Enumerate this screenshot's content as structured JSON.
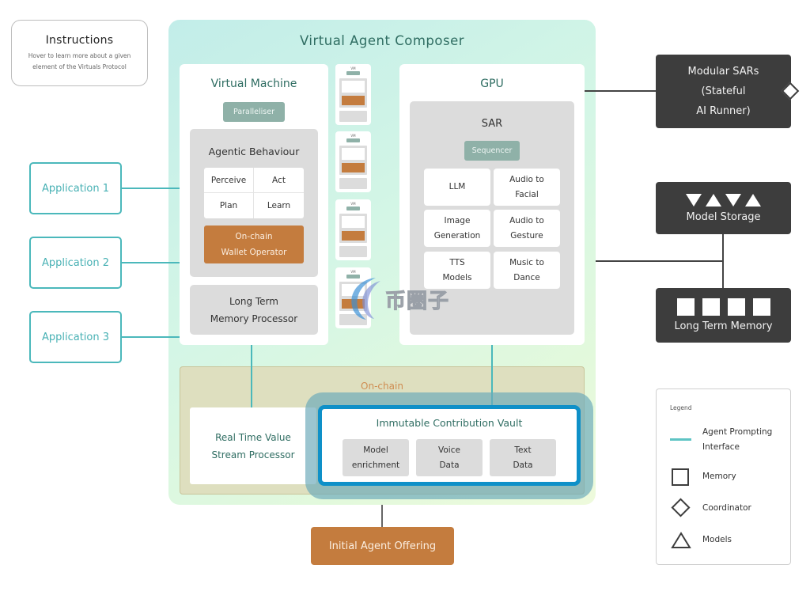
{
  "instructions": {
    "title": "Instructions",
    "description_line1": "Hover to learn more about a given",
    "description_line2": "element of the Virtuals Protocol"
  },
  "applications": [
    {
      "label": "Application 1"
    },
    {
      "label": "Application 2"
    },
    {
      "label": "Application 3"
    }
  ],
  "composer": {
    "title": "Virtual Agent Composer",
    "virtual_machine": {
      "title": "Virtual Machine",
      "paralleliser": "Paralleliser",
      "agentic_behaviour": {
        "title": "Agentic Behaviour",
        "cells": [
          "Perceive",
          "Act",
          "Plan",
          "Learn"
        ],
        "wallet_line1": "On-chain",
        "wallet_line2": "Wallet Operator"
      },
      "long_term_memory_processor_line1": "Long Term",
      "long_term_memory_processor_line2": "Memory Processor"
    },
    "vm_instances": [
      {
        "label": "VM"
      },
      {
        "label": "VM"
      },
      {
        "label": "VM"
      },
      {
        "label": "VM"
      }
    ],
    "gpu": {
      "title": "GPU",
      "sar": {
        "title": "SAR",
        "sequencer": "Sequencer",
        "cells": [
          {
            "line1": "LLM",
            "line2": ""
          },
          {
            "line1": "Audio to",
            "line2": "Facial"
          },
          {
            "line1": "Image",
            "line2": "Generation"
          },
          {
            "line1": "Audio to",
            "line2": "Gesture"
          },
          {
            "line1": "TTS",
            "line2": "Models"
          },
          {
            "line1": "Music to",
            "line2": "Dance"
          }
        ]
      }
    },
    "onchain": {
      "title": "On-chain",
      "rtv_line1": "Real Time Value",
      "rtv_line2": "Stream Processor",
      "vault": {
        "title": "Immutable Contribution Vault",
        "cells": [
          {
            "line1": "Model",
            "line2": "enrichment"
          },
          {
            "line1": "Voice",
            "line2": "Data"
          },
          {
            "line1": "Text",
            "line2": "Data"
          }
        ]
      }
    }
  },
  "right_nodes": {
    "modular_sars_line1": "Modular SARs",
    "modular_sars_line2": "(Stateful",
    "modular_sars_line3": "AI Runner)",
    "model_storage": "Model Storage",
    "long_term_memory": "Long Term Memory"
  },
  "initial_agent_offering": "Initial Agent Offering",
  "legend": {
    "title": "Legend",
    "items": [
      {
        "icon": "teal-line-icon",
        "line1": "Agent Prompting",
        "line2": "Interface"
      },
      {
        "icon": "square-icon",
        "line1": "Memory"
      },
      {
        "icon": "diamond-icon",
        "line1": "Coordinator"
      },
      {
        "icon": "triangle-icon",
        "line1": "Models"
      }
    ]
  },
  "watermark": "币圈子",
  "colors": {
    "teal_accent": "#4bb8bb",
    "orange_accent": "#c47c3e",
    "vault_blue": "#0e90c8",
    "dark_node": "#3d3d3d",
    "chip_green": "#8fb1a8"
  }
}
